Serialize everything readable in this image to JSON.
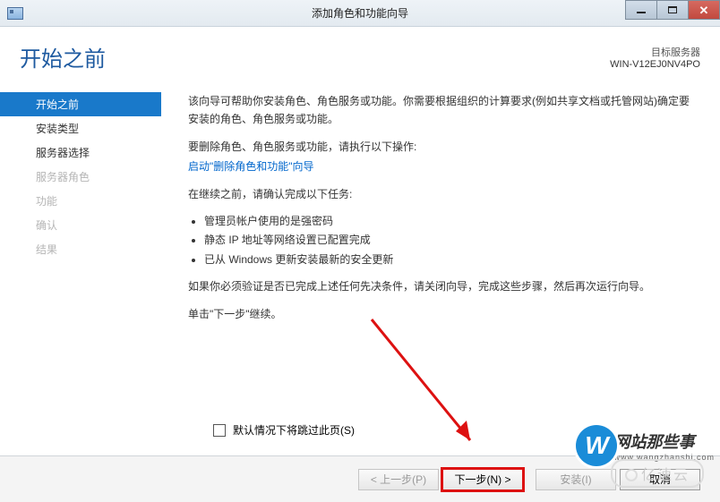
{
  "window": {
    "title": "添加角色和功能向导"
  },
  "header": {
    "page_title": "开始之前",
    "target_label": "目标服务器",
    "target_server": "WIN-V12EJ0NV4PO"
  },
  "sidebar": {
    "items": [
      {
        "label": "开始之前",
        "state": "selected"
      },
      {
        "label": "安装类型",
        "state": "enabled"
      },
      {
        "label": "服务器选择",
        "state": "enabled"
      },
      {
        "label": "服务器角色",
        "state": "disabled"
      },
      {
        "label": "功能",
        "state": "disabled"
      },
      {
        "label": "确认",
        "state": "disabled"
      },
      {
        "label": "结果",
        "state": "disabled"
      }
    ]
  },
  "content": {
    "intro": "该向导可帮助你安装角色、角色服务或功能。你需要根据组织的计算要求(例如共享文档或托管网站)确定要安装的角色、角色服务或功能。",
    "remove_label": "要删除角色、角色服务或功能，请执行以下操作:",
    "remove_link": "启动\"删除角色和功能\"向导",
    "tasks_label": "在继续之前，请确认完成以下任务:",
    "bullets": [
      "管理员帐户使用的是强密码",
      "静态 IP 地址等网络设置已配置完成",
      "已从 Windows 更新安装最新的安全更新"
    ],
    "verify": "如果你必须验证是否已完成上述任何先决条件，请关闭向导，完成这些步骤，然后再次运行向导。",
    "continue": "单击\"下一步\"继续。",
    "skip_checkbox": "默认情况下将跳过此页(S)"
  },
  "footer": {
    "prev": "< 上一步(P)",
    "next": "下一步(N) >",
    "install": "安装(I)",
    "cancel": "取消"
  },
  "watermark": {
    "letter": "W",
    "main": "网站那些事",
    "sub": "www.wangzhanshi.com",
    "brand2": "亿速云"
  }
}
